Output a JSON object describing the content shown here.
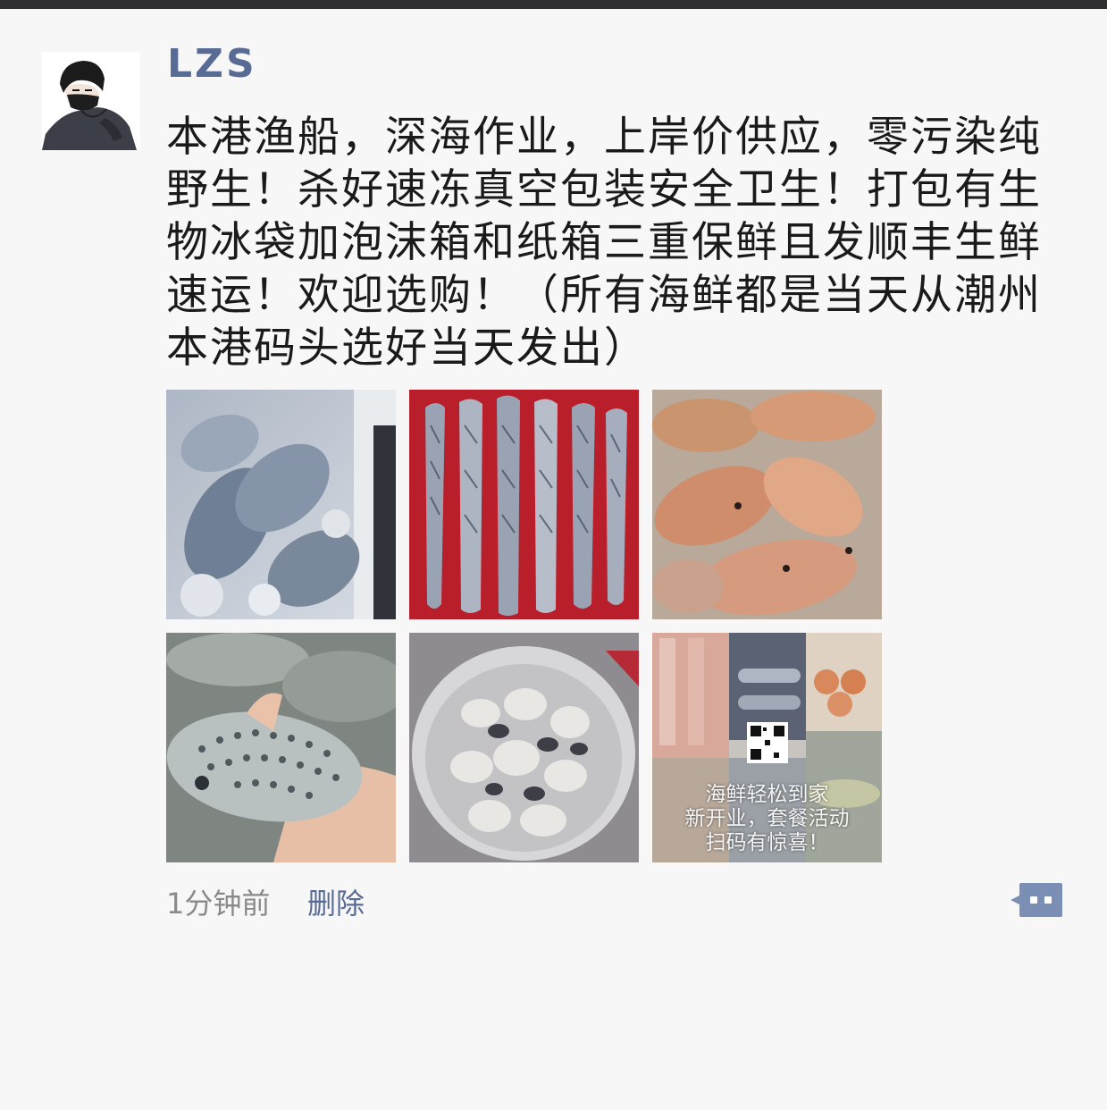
{
  "post": {
    "author": "LZS",
    "text": "本港渔船，深海作业，上岸价供应，零污染纯野生！杀好速冻真空包装安全卫生！打包有生物冰袋加泡沫箱和纸箱三重保鲜且发顺丰生鲜速运！欢迎选购！（所有海鲜都是当天从潮州本港码头选好当天发出）",
    "photos": [
      {
        "icon": "frozen-fish-photo"
      },
      {
        "icon": "mackerel-photo"
      },
      {
        "icon": "parrotfish-photo"
      },
      {
        "icon": "spotted-fish-photo"
      },
      {
        "icon": "oysters-photo"
      },
      {
        "icon": "promo-collage-photo"
      }
    ],
    "promo_lines": [
      "海鲜轻松到家",
      "新开业，套餐活动",
      "扫码有惊喜！"
    ],
    "timestamp": "1分钟前",
    "delete_label": "删除",
    "comment_icon": "comment-dots-icon"
  },
  "colors": {
    "author": "#576b95",
    "link": "#576b95",
    "timestamp": "#8a8a8a",
    "background": "#f7f7f7"
  }
}
